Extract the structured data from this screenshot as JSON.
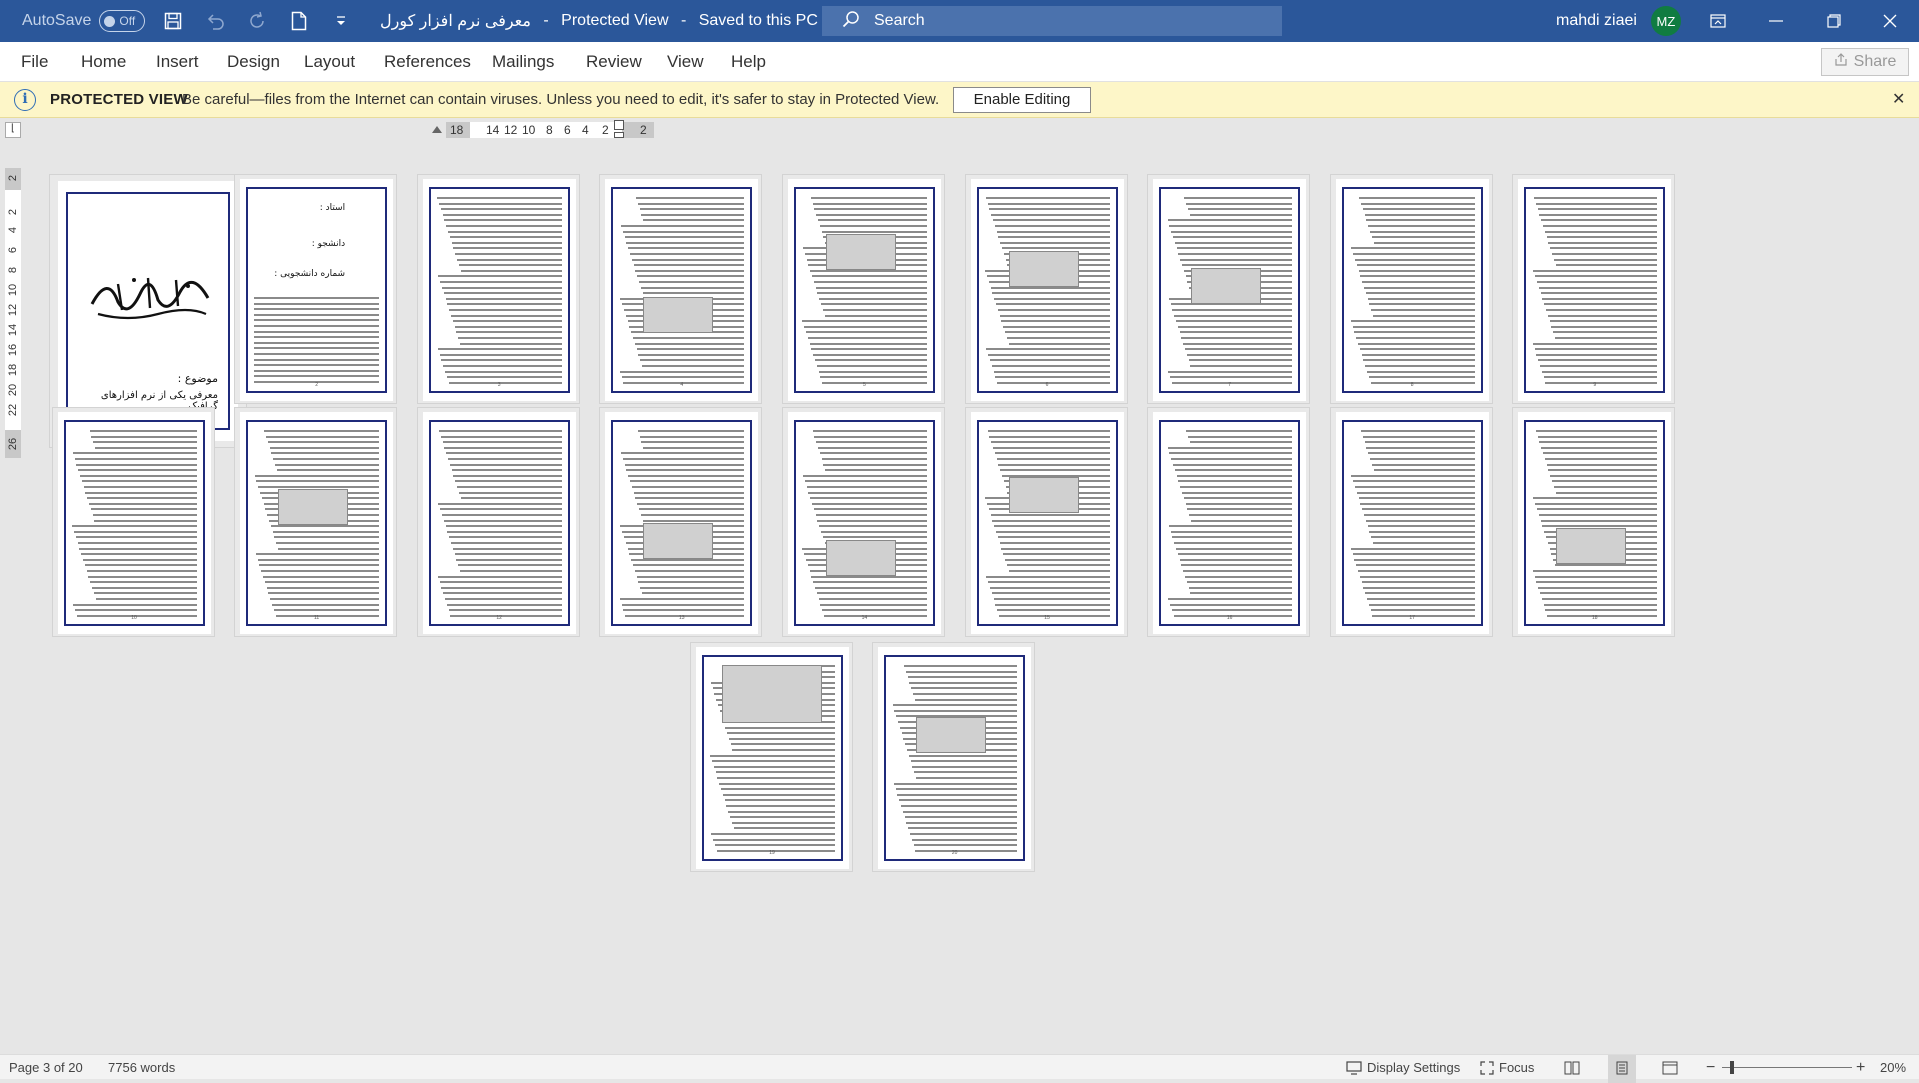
{
  "titlebar": {
    "autosave_label": "AutoSave",
    "autosave_state": "Off",
    "doc_name": "معرفی نرم افزار کورل",
    "view_state": "Protected View",
    "save_state": "Saved to this PC",
    "search_placeholder": "Search",
    "user_name": "mahdi ziaei",
    "user_initials": "MZ"
  },
  "menu": {
    "items": [
      "File",
      "Home",
      "Insert",
      "Design",
      "Layout",
      "References",
      "Mailings",
      "Review",
      "View",
      "Help"
    ],
    "share_label": "Share"
  },
  "protected_view": {
    "title": "PROTECTED VIEW",
    "message": "Be careful—files from the Internet can contain viruses. Unless you need to edit, it's safer to stay in Protected View.",
    "enable_label": "Enable Editing"
  },
  "ruler": {
    "h_numbers": [
      "18",
      "14",
      "12",
      "10",
      "8",
      "6",
      "4",
      "2",
      "2"
    ],
    "v_numbers": [
      "2",
      "2",
      "4",
      "6",
      "8",
      "10",
      "12",
      "14",
      "16",
      "18",
      "20",
      "22",
      "26"
    ]
  },
  "cover": {
    "teacher_label": "استاد :",
    "student_label": "دانشجو :",
    "student_id_label": "شماره دانشجویی :",
    "subject_label": "موضوع :",
    "subject_value": "معرفی یکی از نرم افزارهای گرافیک",
    "calligraphy": "بسم الله الرحمن الرحیم"
  },
  "pages_count": 20,
  "statusbar": {
    "page_info": "Page 3 of 20",
    "words": "7756 words",
    "display_settings": "Display Settings",
    "focus": "Focus",
    "zoom": "20%"
  },
  "colors": {
    "title_blue": "#2b579a",
    "warning_bg": "#fdf6c8",
    "page_border": "#1f2a7a"
  }
}
